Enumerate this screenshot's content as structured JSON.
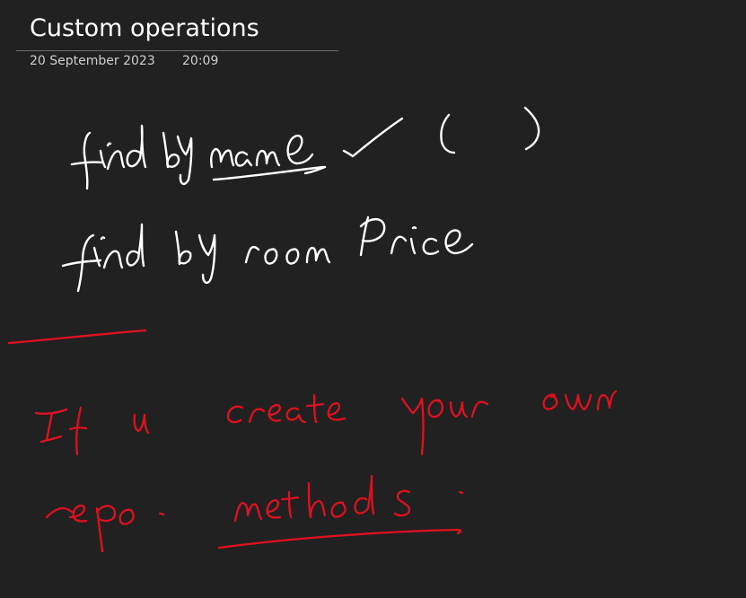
{
  "page": {
    "title": "Custom operations",
    "date": "20 September 2023",
    "time": "20:09"
  },
  "ink": {
    "white_lines": [
      "find By name",
      "( )",
      "find by room Price"
    ],
    "red_lines": [
      "If u create your own",
      "repo. methods ."
    ],
    "colors": {
      "background": "#222121",
      "white_ink": "#ffffff",
      "red_ink": "#e0111f"
    }
  }
}
